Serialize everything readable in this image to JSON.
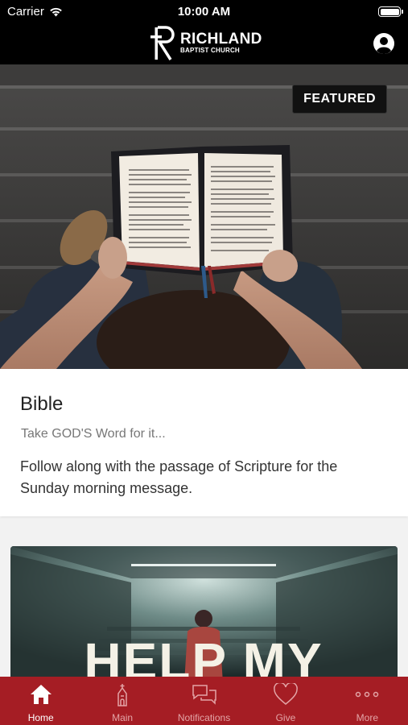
{
  "status_bar": {
    "carrier": "Carrier",
    "time": "10:00 AM"
  },
  "header": {
    "logo_title": "RICHLAND",
    "logo_subtitle": "BAPTIST CHURCH",
    "profile_icon": "person-circle-icon"
  },
  "featured": {
    "badge": "FEATURED",
    "title": "Bible",
    "subtitle": "Take GOD'S Word for it...",
    "description": "Follow along with the passage of Scripture for the Sunday morning message."
  },
  "second_card": {
    "image_text": "HELP MY"
  },
  "tabs": [
    {
      "label": "Home",
      "icon": "house-icon",
      "active": true
    },
    {
      "label": "Main",
      "icon": "church-icon",
      "active": false
    },
    {
      "label": "Notifications",
      "icon": "chat-bubbles-icon",
      "active": false
    },
    {
      "label": "Give",
      "icon": "heart-icon",
      "active": false
    },
    {
      "label": "More",
      "icon": "ellipsis-icon",
      "active": false
    }
  ],
  "colors": {
    "header_bg": "#000000",
    "tabbar_bg": "#a51d24",
    "tab_active": "#ffffff",
    "tab_inactive": "#e3a4a6"
  }
}
